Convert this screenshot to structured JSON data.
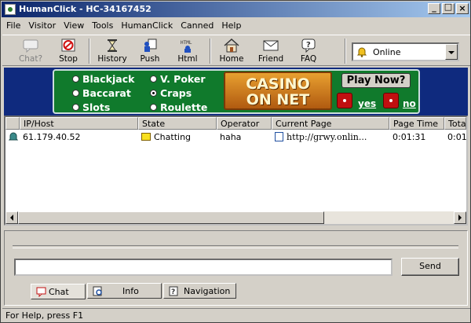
{
  "window": {
    "title": "HumanClick - HC-34167452"
  },
  "menu": [
    "File",
    "Visitor",
    "View",
    "Tools",
    "HumanClick",
    "Canned",
    "Help"
  ],
  "toolbar": {
    "chat": "Chat?",
    "stop": "Stop",
    "history": "History",
    "push": "Push",
    "html": "Html",
    "home": "Home",
    "friend": "Friend",
    "faq": "FAQ"
  },
  "status_select": {
    "value": "Online"
  },
  "banner": {
    "options": [
      "Blackjack",
      "V. Poker",
      "Baccarat",
      "Craps",
      "Slots",
      "Roulette"
    ],
    "selected": "Craps",
    "logo_line1": "CASINO",
    "logo_line2": "ON NET",
    "play_now": "Play Now?",
    "yes": "yes",
    "no": "no"
  },
  "visitors": {
    "columns": [
      "IP/Host",
      "State",
      "Operator",
      "Current Page",
      "Page Time",
      "Tota"
    ],
    "rows": [
      {
        "ip": "61.179.40.52",
        "state": "Chatting",
        "operator": "haha",
        "page": "http://grwy.onlin...",
        "page_time": "0:01:31",
        "total": "0:01"
      }
    ]
  },
  "chat": {
    "send": "Send",
    "input_value": ""
  },
  "tabs": [
    "Chat",
    "Info",
    "Navigation"
  ],
  "statusbar": {
    "text": "For Help, press F1"
  }
}
